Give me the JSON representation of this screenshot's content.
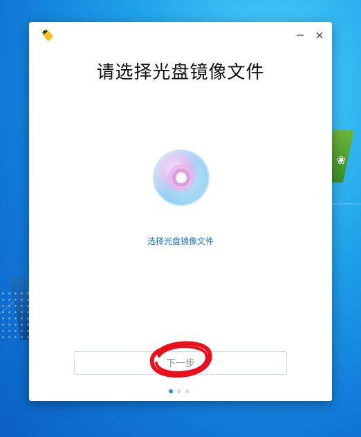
{
  "dialog": {
    "title": "请选择光盘镜像文件",
    "select_link": "选择光盘镜像文件",
    "next_label": "下一步",
    "window_controls": [
      "minimize-icon",
      "close-icon"
    ],
    "app_icon": "usb-drive-icon",
    "disc_icon": "disc-icon",
    "pager": {
      "pages": 3,
      "current": 1
    }
  },
  "colors": {
    "accent": "#2f8ee5",
    "link": "#1a73c9",
    "annotation": "#e8101a",
    "app_icon": "#f6c21a"
  }
}
